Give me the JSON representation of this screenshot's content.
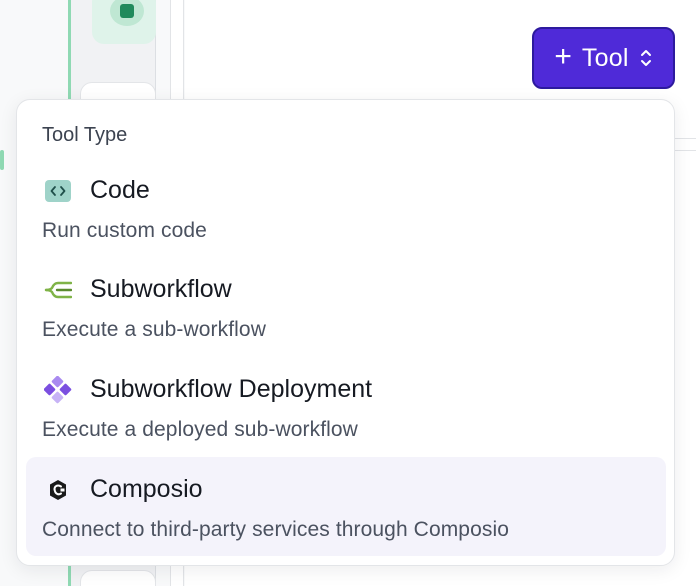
{
  "toolbar": {
    "add_tool_label": "Tool",
    "add_tool_plus": "+"
  },
  "menu": {
    "heading": "Tool Type",
    "items": [
      {
        "title": "Code",
        "description": "Run custom code",
        "icon": "code-icon"
      },
      {
        "title": "Subworkflow",
        "description": "Execute a sub-workflow",
        "icon": "subworkflow-icon"
      },
      {
        "title": "Subworkflow Deployment",
        "description": "Execute a deployed sub-workflow",
        "icon": "deployment-icon"
      },
      {
        "title": "Composio",
        "description": "Connect to third-party services through Composio",
        "icon": "composio-icon"
      }
    ],
    "highlighted_index": 3
  },
  "colors": {
    "accent": "#4f2ad8",
    "accent_border": "#2d1a9e",
    "highlight_bg": "#f4f3fb",
    "code_icon": "#9fd3c9",
    "subworkflow_icon": "#7fb347",
    "deployment_icon": "#7b4fe0"
  }
}
